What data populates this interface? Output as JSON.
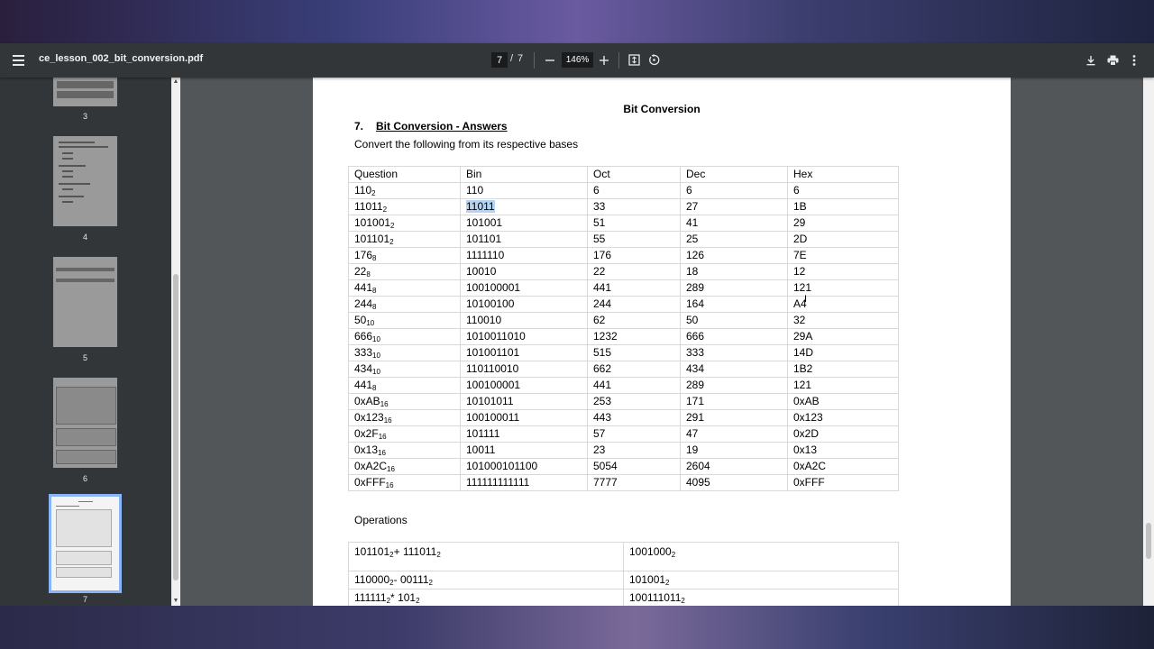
{
  "toolbar": {
    "filename": "ce_lesson_002_bit_conversion.pdf",
    "current_page": "7",
    "page_separator": "/",
    "total_pages": "7",
    "zoom": "146%"
  },
  "sidebar": {
    "thumbnails": [
      {
        "label": "3"
      },
      {
        "label": "4"
      },
      {
        "label": "5"
      },
      {
        "label": "6"
      },
      {
        "label": "7",
        "selected": true
      }
    ]
  },
  "document": {
    "title": "Bit Conversion",
    "section_number": "7.",
    "section_title": "Bit Conversion - Answers",
    "instruction": "Convert the following from its respective bases",
    "headers": [
      "Question",
      "Bin",
      "Oct",
      "Dec",
      "Hex"
    ],
    "rows": [
      {
        "q": "110",
        "base": "2",
        "bin": "110",
        "oct": "6",
        "dec": "6",
        "hex": "6"
      },
      {
        "q": "11011",
        "base": "2",
        "bin": "11011",
        "oct": "33",
        "dec": "27",
        "hex": "1B"
      },
      {
        "q": "101001",
        "base": "2",
        "bin": "101001",
        "oct": "51",
        "dec": "41",
        "hex": "29"
      },
      {
        "q": "101101",
        "base": "2",
        "bin": "101101",
        "oct": "55",
        "dec": "25",
        "hex": "2D"
      },
      {
        "q": "176",
        "base": "8",
        "bin": "1111110",
        "oct": "176",
        "dec": "126",
        "hex": "7E"
      },
      {
        "q": "22",
        "base": "8",
        "bin": "10010",
        "oct": "22",
        "dec": "18",
        "hex": "12"
      },
      {
        "q": "441",
        "base": "8",
        "bin": "100100001",
        "oct": "441",
        "dec": "289",
        "hex": "121"
      },
      {
        "q": "244",
        "base": "8",
        "bin": "10100100",
        "oct": "244",
        "dec": "164",
        "hex": "A4"
      },
      {
        "q": "50",
        "base": "10",
        "bin": "110010",
        "oct": "62",
        "dec": "50",
        "hex": "32"
      },
      {
        "q": "666",
        "base": "10",
        "bin": "1010011010",
        "oct": "1232",
        "dec": "666",
        "hex": "29A"
      },
      {
        "q": "333",
        "base": "10",
        "bin": "101001101",
        "oct": "515",
        "dec": "333",
        "hex": "14D"
      },
      {
        "q": "434",
        "base": "10",
        "bin": "110110010",
        "oct": "662",
        "dec": "434",
        "hex": "1B2"
      },
      {
        "q": "441",
        "base": "8",
        "bin": "100100001",
        "oct": "441",
        "dec": "289",
        "hex": "121"
      },
      {
        "q": "0xAB",
        "base": "16",
        "bin": "10101011",
        "oct": "253",
        "dec": "171",
        "hex": "0xAB"
      },
      {
        "q": "0x123",
        "base": "16",
        "bin": "100100011",
        "oct": "443",
        "dec": "291",
        "hex": "0x123"
      },
      {
        "q": "0x2F",
        "base": "16",
        "bin": "101111",
        "oct": "57",
        "dec": "47",
        "hex": "0x2D"
      },
      {
        "q": "0x13",
        "base": "16",
        "bin": "10011",
        "oct": "23",
        "dec": "19",
        "hex": "0x13"
      },
      {
        "q": "0xA2C",
        "base": "16",
        "bin": "101000101100",
        "oct": "5054",
        "dec": "2604",
        "hex": "0xA2C"
      },
      {
        "q": "0xFFF",
        "base": "16",
        "bin": "111111111111",
        "oct": "7777",
        "dec": "4095",
        "hex": "0xFFF"
      }
    ],
    "operations_title": "Operations",
    "operations": [
      {
        "a": "101101",
        "a_base": "2",
        "op": "+ ",
        "b": "111011",
        "b_base": "2",
        "result": "1001000",
        "result_base": "2"
      },
      {
        "a": "110000",
        "a_base": "2",
        "op": "- ",
        "b": "00111",
        "b_base": "2",
        "result": "101001",
        "result_base": "2"
      },
      {
        "a": "111111",
        "a_base": "2",
        "op": "* ",
        "b": "101",
        "b_base": "2",
        "result": "100111011",
        "result_base": "2"
      }
    ]
  },
  "icons": {
    "menu": "menu-icon",
    "zoom_out": "minus-icon",
    "zoom_in": "plus-icon",
    "fit": "fit-page-icon",
    "rotate": "rotate-icon",
    "download": "download-icon",
    "print": "print-icon",
    "more": "more-vert-icon"
  },
  "colors": {
    "toolbar_bg": "#323639",
    "viewer_bg": "#525659",
    "selected_thumb_outline": "#8ab4f8",
    "selection_highlight": "#b3d4f5"
  }
}
